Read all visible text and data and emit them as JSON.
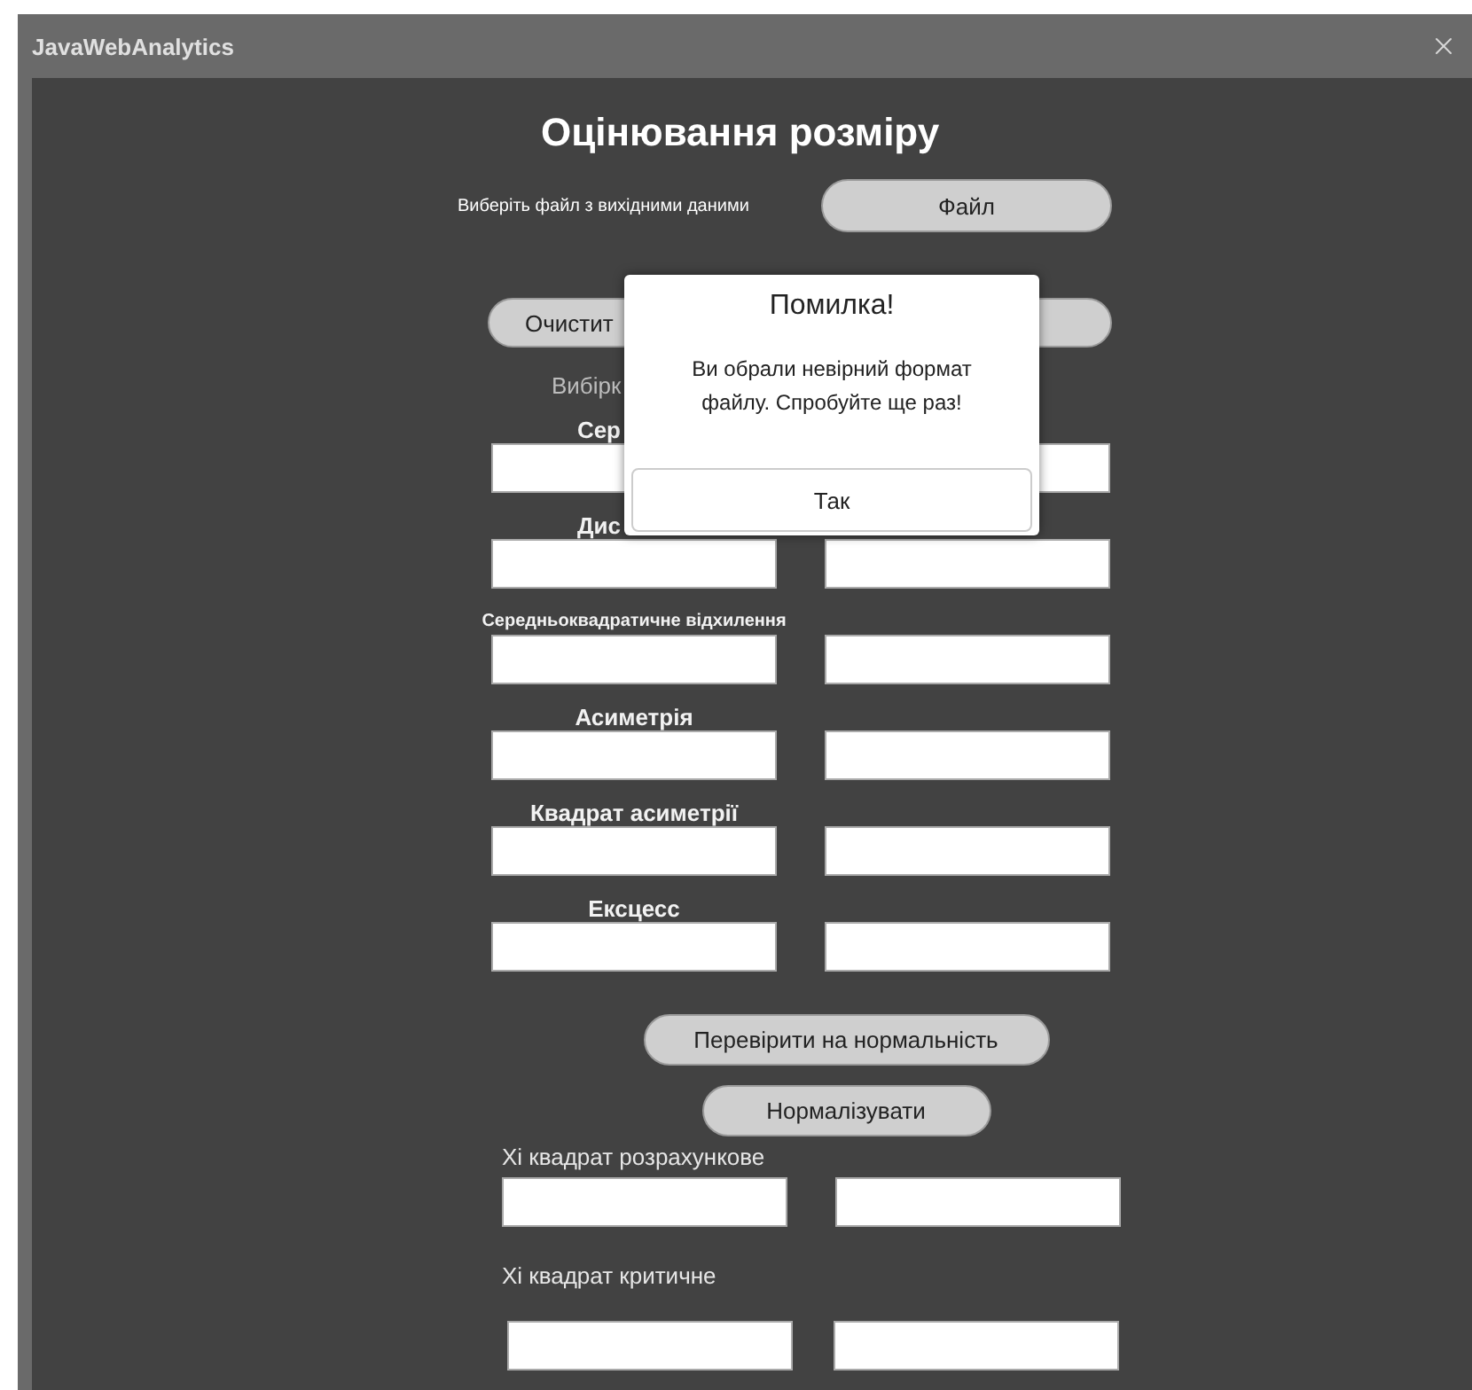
{
  "window": {
    "title": "JavaWebAnalytics"
  },
  "heading": "Оцінювання розміру",
  "file_row": {
    "label": "Виберіть файл з вихідними даними",
    "button": "Файл"
  },
  "clear_button": "Очистит",
  "sample_label": "Вибірк",
  "metrics": [
    {
      "label": "Сер",
      "kind": "clipped"
    },
    {
      "label": "Дис",
      "kind": "clipped"
    },
    {
      "label": "Середньоквадратичне відхилення",
      "kind": "small"
    },
    {
      "label": "Асиметрія",
      "kind": "large"
    },
    {
      "label": "Квадрат асиметрії",
      "kind": "large"
    },
    {
      "label": "Ексцесс",
      "kind": "large"
    }
  ],
  "normality_button": "Перевірити на нормальність",
  "normalize_button": "Нормалізувати",
  "chi_fields": [
    {
      "label": "Хі квадрат розрахункове"
    },
    {
      "label": "Хі квадрат критичне"
    }
  ],
  "dialog": {
    "title": "Помилка!",
    "message": "Ви обрали невірний формат файлу. Спробуйте ще раз!",
    "button": "Так"
  }
}
